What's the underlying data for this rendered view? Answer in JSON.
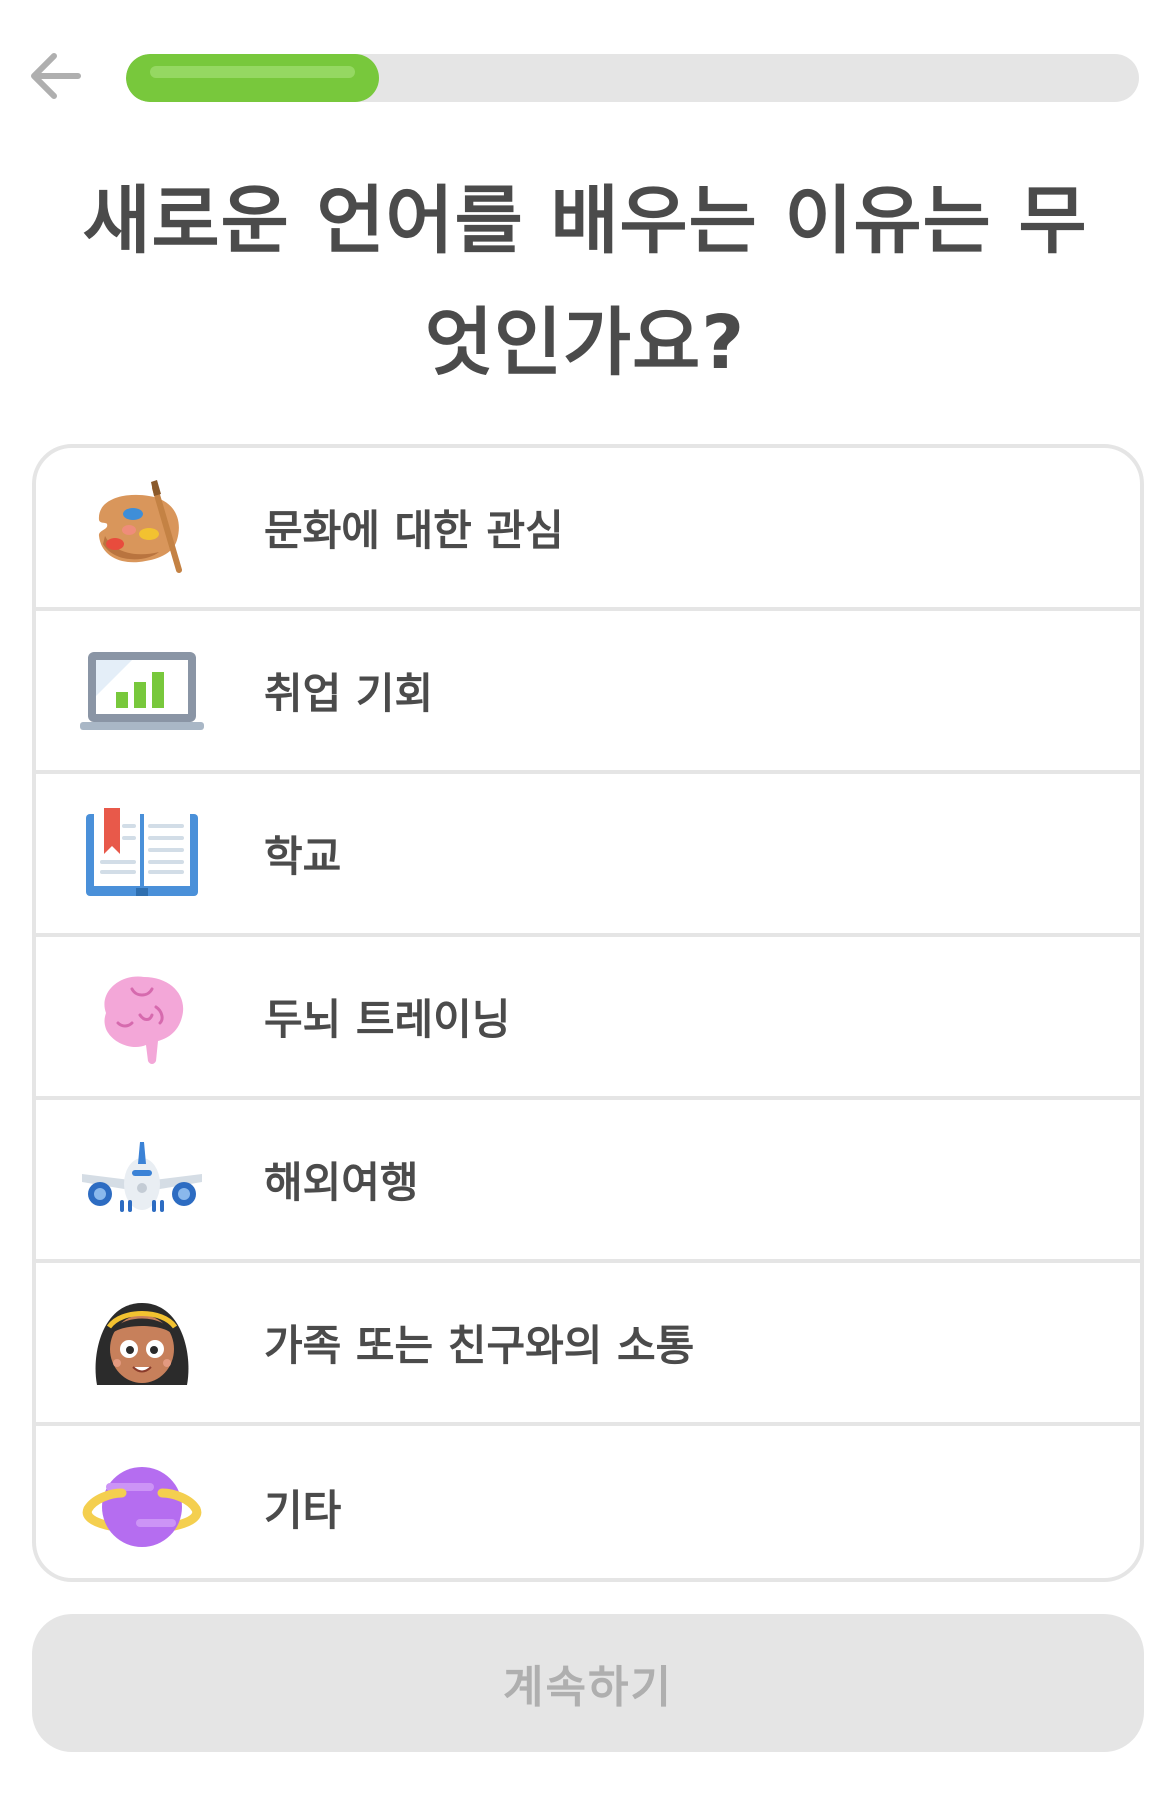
{
  "header": {
    "back_icon": "arrow-left-icon",
    "progress_fraction": 0.25,
    "colors": {
      "progress_fill": "#78c83c",
      "progress_track": "#e5e5e5"
    }
  },
  "question": {
    "text": "새로운 언어를 배우는 이유는 무엇인가요?"
  },
  "options": [
    {
      "label": "문화에 대한 관심",
      "icon": "palette-icon"
    },
    {
      "label": "취업 기회",
      "icon": "laptop-chart-icon"
    },
    {
      "label": "학교",
      "icon": "open-book-icon"
    },
    {
      "label": "두뇌 트레이닝",
      "icon": "brain-icon"
    },
    {
      "label": "해외여행",
      "icon": "airplane-icon"
    },
    {
      "label": "가족 또는 친구와의 소통",
      "icon": "girl-face-icon"
    },
    {
      "label": "기타",
      "icon": "planet-icon"
    }
  ],
  "footer": {
    "continue_label": "계속하기",
    "continue_enabled": false
  }
}
